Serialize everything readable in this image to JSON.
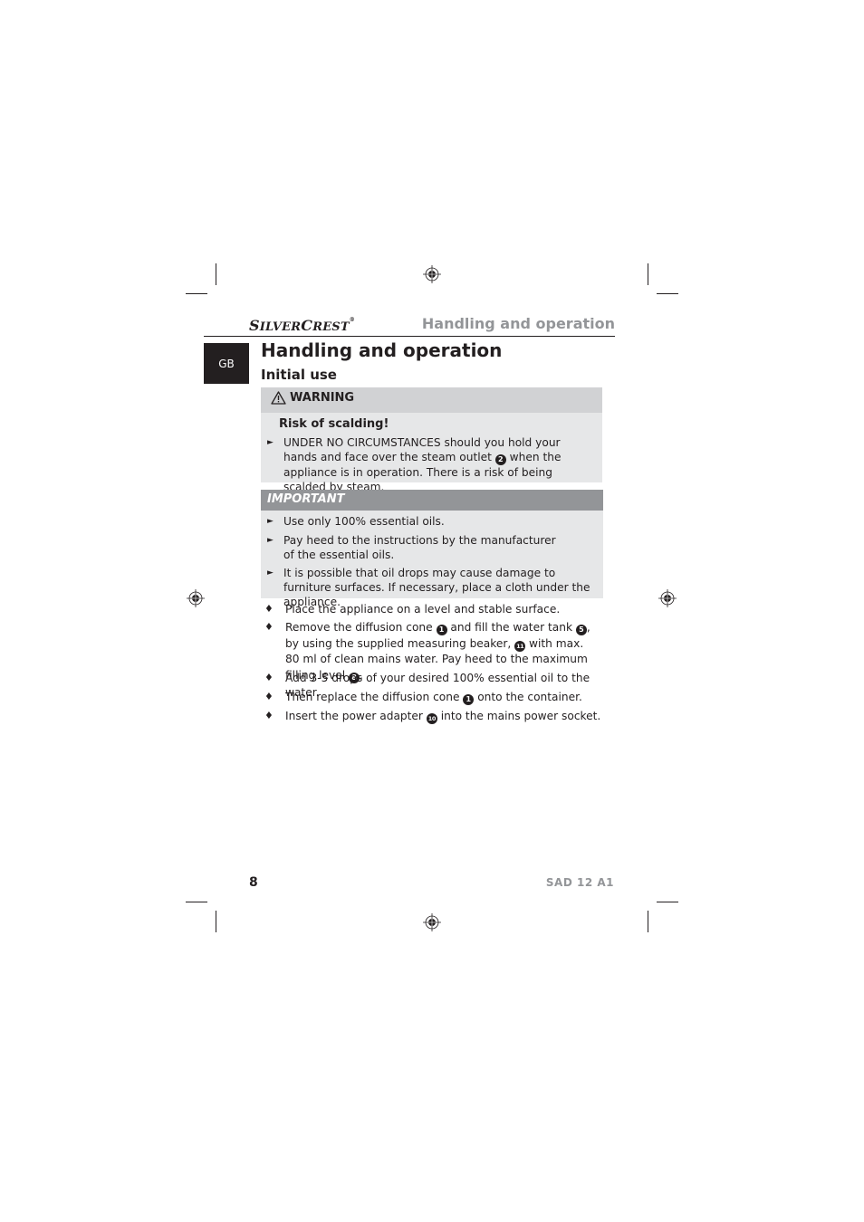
{
  "header": {
    "brand_part1_cap": "S",
    "brand_part1_rest": "ILVER",
    "brand_part2_cap": "C",
    "brand_part2_rest": "REST",
    "brand_mark": "®",
    "section_title": "Handling and operation"
  },
  "language_tab": "GB",
  "main": {
    "title": "Handling and operation",
    "subtitle": "Initial use"
  },
  "warning": {
    "icon": "warning-triangle-icon",
    "label": "WARNING",
    "risk_title": "Risk of scalding!",
    "items": [
      {
        "before": "UNDER NO CIRCUMSTANCES should you hold your hands and face over the steam outlet",
        "ref": "2",
        "after": "when the appliance is in operation. There is a risk of being scalded by steam."
      }
    ]
  },
  "important": {
    "label": "IMPORTANT",
    "items": [
      "Use only 100% essential oils.",
      "Pay heed to the instructions by the manufacturer of the essential oils.",
      "It is possible that oil drops may cause damage to furniture surfaces. If necessary, place a cloth under the appliance."
    ]
  },
  "steps": [
    {
      "text": "Place the appliance on a level and stable surface."
    },
    {
      "p1": "Remove the diffusion cone",
      "r1": "1",
      "p2": "and fill the water tank",
      "r2": "5",
      "p3": ", by using the supplied measuring beaker,",
      "r3": "11",
      "p4": "with max. 80 ml of clean mains water. Pay heed to the maximum filling level",
      "r4": "8",
      "p5": "."
    },
    {
      "text": "Add 3-5 drops of your desired 100% essential oil to the water."
    },
    {
      "p1": "Then replace the diffusion cone",
      "r1": "1",
      "p2": "onto the container."
    },
    {
      "p1": "Insert the power adapter",
      "r1": "10",
      "p2": "into the mains power socket."
    }
  ],
  "footer": {
    "page_number": "8",
    "model": "SAD 12 A1"
  },
  "glyphs": {
    "arrow": "►",
    "diamond": "♦",
    "warning": "⚠"
  }
}
